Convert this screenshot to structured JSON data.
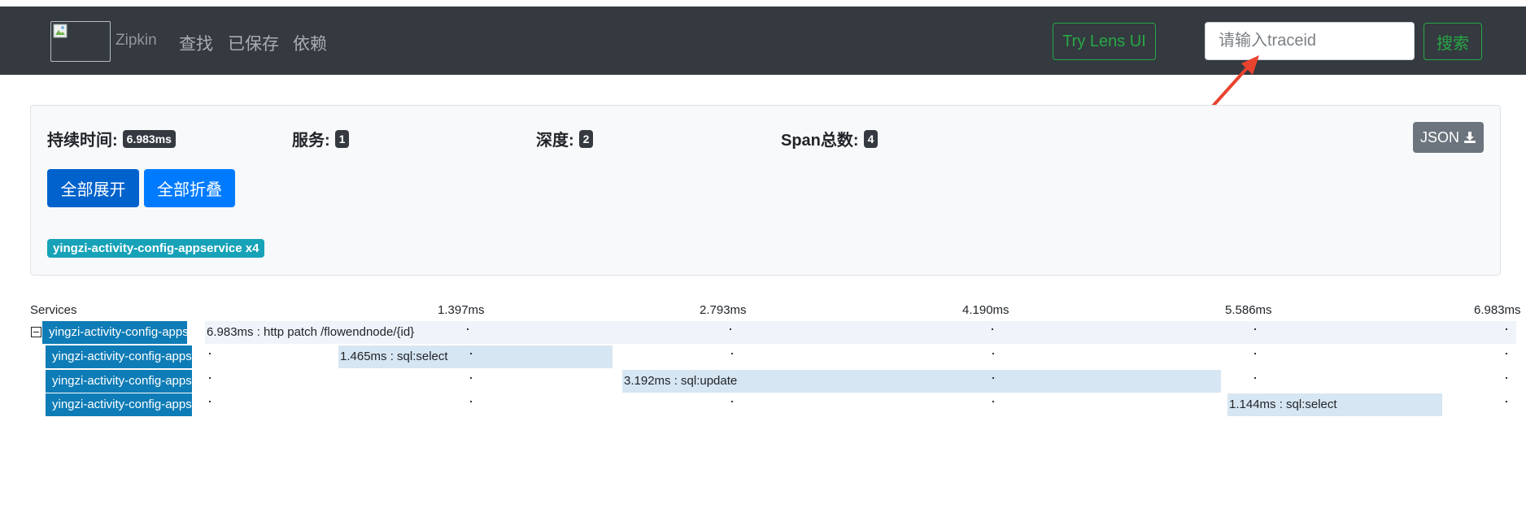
{
  "navbar": {
    "brand": "Zipkin",
    "links": [
      "查找",
      "已保存",
      "依赖"
    ],
    "lens_button": "Try Lens UI",
    "search_placeholder": "请输入traceid",
    "search_button": "搜索"
  },
  "summary": {
    "duration_label": "持续时间:",
    "duration_value": "6.983ms",
    "services_label": "服务:",
    "services_value": "1",
    "depth_label": "深度:",
    "depth_value": "2",
    "spans_label": "Span总数:",
    "spans_value": "4",
    "json_button": "JSON",
    "expand_all": "全部展开",
    "collapse_all": "全部折叠",
    "service_badge": "yingzi-activity-config-appservice x4"
  },
  "timeline": {
    "services_header": "Services",
    "ticks": [
      "1.397ms",
      "2.793ms",
      "4.190ms",
      "5.586ms",
      "6.983ms"
    ],
    "spans": [
      {
        "service": "yingzi-activity-config-appservice",
        "label": "6.983ms : http patch /flowendnode/{id}"
      },
      {
        "service": "yingzi-activity-config-appservice",
        "label": "1.465ms : sql:select"
      },
      {
        "service": "yingzi-activity-config-appservice",
        "label": "3.192ms : sql:update"
      },
      {
        "service": "yingzi-activity-config-appservice",
        "label": "1.144ms : sql:select"
      }
    ]
  },
  "colors": {
    "navbar_bg": "#343a40",
    "success": "#28a745",
    "primary": "#007bff",
    "primary_active": "#0062cc",
    "info": "#17a2b8",
    "service_label_bg": "#0e7cb6",
    "annotation_arrow": "#e8432f"
  },
  "icons": [
    "broken-image-icon",
    "download-icon",
    "collapse-toggle-icon",
    "annotation-arrow-icon"
  ]
}
